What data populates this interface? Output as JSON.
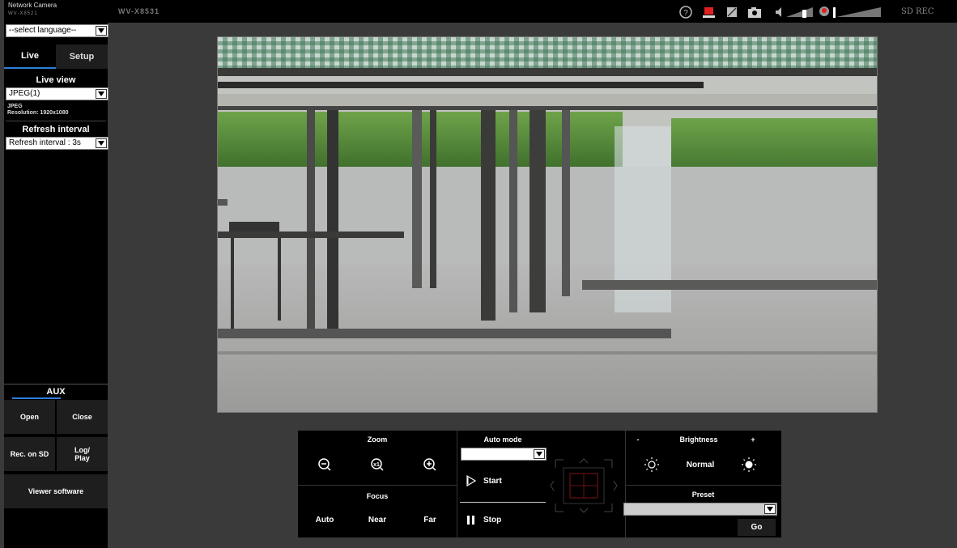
{
  "brand": {
    "app_name": "Network Camera",
    "model": "WV-X8521"
  },
  "header": {
    "camera_title": "WV-X8531",
    "sd_status": "SD REC"
  },
  "language": {
    "selected": "--select language--"
  },
  "tabs": {
    "live": "Live",
    "setup": "Setup"
  },
  "live_view": {
    "title": "Live view",
    "stream": "JPEG(1)",
    "format": "JPEG",
    "resolution": "Resolution: 1920x1080"
  },
  "refresh": {
    "title": "Refresh interval",
    "selected": "Refresh interval : 3s"
  },
  "aux": {
    "title": "AUX",
    "open": "Open",
    "close": "Close",
    "rec_sd": "Rec. on SD",
    "log_play": "Log/\nPlay",
    "viewer": "Viewer software"
  },
  "zoom": {
    "title": "Zoom"
  },
  "focus": {
    "title": "Focus",
    "auto": "Auto",
    "near": "Near",
    "far": "Far"
  },
  "automode": {
    "title": "Auto mode",
    "start": "Start",
    "stop": "Stop",
    "selected": ""
  },
  "brightness": {
    "title": "Brightness",
    "minus": "-",
    "plus": "+",
    "normal": "Normal"
  },
  "preset": {
    "title": "Preset",
    "selected": "",
    "go": "Go"
  },
  "colors": {
    "accent": "#2e7fd6",
    "panel": "#000000",
    "background": "#3a3a3a"
  }
}
